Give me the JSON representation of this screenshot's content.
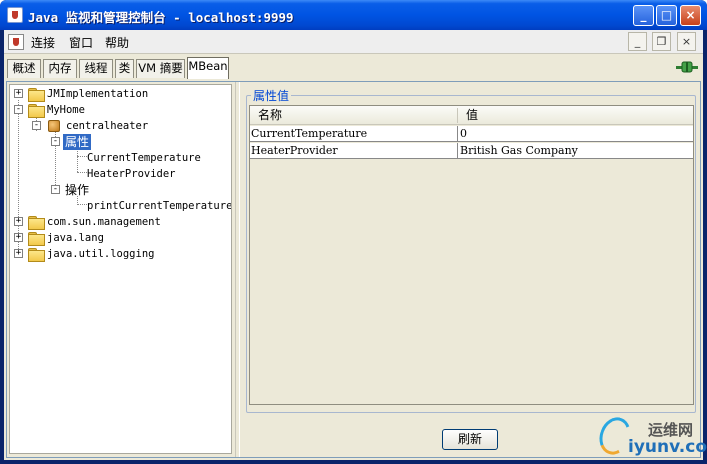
{
  "window": {
    "title": "Java 监视和管理控制台 - localhost:9999",
    "minimize": "_",
    "maximize": "□",
    "close": "×"
  },
  "menu": {
    "items": [
      "连接",
      "窗口",
      "帮助"
    ],
    "mdi_minimize": "_",
    "mdi_restore": "❐",
    "mdi_close": "×"
  },
  "tabs": [
    "概述",
    "内存",
    "线程",
    "类",
    "VM 摘要",
    "MBean"
  ],
  "active_tab": "MBean",
  "tree": {
    "jmimplementation": "JMImplementation",
    "myhome": "MyHome",
    "centralheater": "centralheater",
    "attributes": "属性",
    "current_temperature": "CurrentTemperature",
    "heater_provider": "HeaterProvider",
    "operations": "操作",
    "print_current_temperature": "printCurrentTemperature",
    "com_sun_management": "com.sun.management",
    "java_lang": "java.lang",
    "java_util_logging": "java.util.logging",
    "expand": "+",
    "collapse": "-"
  },
  "attributes_panel": {
    "legend": "属性值",
    "columns": [
      "名称",
      "值"
    ],
    "rows": [
      {
        "name": "CurrentTemperature",
        "value": "0"
      },
      {
        "name": "HeaterProvider",
        "value": "British Gas Company"
      }
    ],
    "refresh_label": "刷新"
  },
  "watermark": {
    "top": "运维网",
    "bottom": "iyunv.com"
  }
}
